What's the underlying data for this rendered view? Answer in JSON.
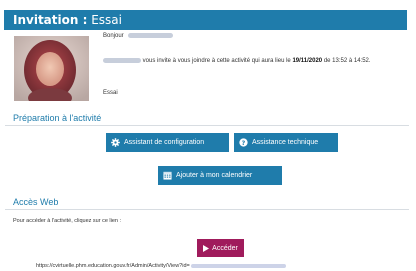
{
  "header": {
    "prefix": "Invitation :",
    "title": "Essai",
    "background_color": "#1f7cab"
  },
  "message": {
    "greeting": "Bonjour",
    "invite_text": "vous invite à vous joindre à cette activité qui aura lieu le",
    "date": "19/11/2020",
    "time_connector": "de",
    "time_range": "13:52 à 14:52.",
    "activity_name": "Essai"
  },
  "preparation": {
    "section_title": "Préparation à l'activité",
    "config_button_label": "Assistant de configuration",
    "config_button_icon": "gear-icon",
    "support_button_label": "Assistance technique",
    "support_button_icon": "question-circle-icon",
    "calendar_button_label": "Ajouter à mon calendrier",
    "calendar_button_icon": "calendar-icon"
  },
  "web_access": {
    "section_title": "Accès Web",
    "instructions": "Pour accéder à l'activité, cliquez sur ce lien :",
    "join_button_label": "Accéder",
    "join_button_icon": "play-icon",
    "join_button_color": "#a01b5c",
    "url_visible": "https://cvirtuelle.phm.education.gouv.fr/Admin/Activity/View?id="
  }
}
